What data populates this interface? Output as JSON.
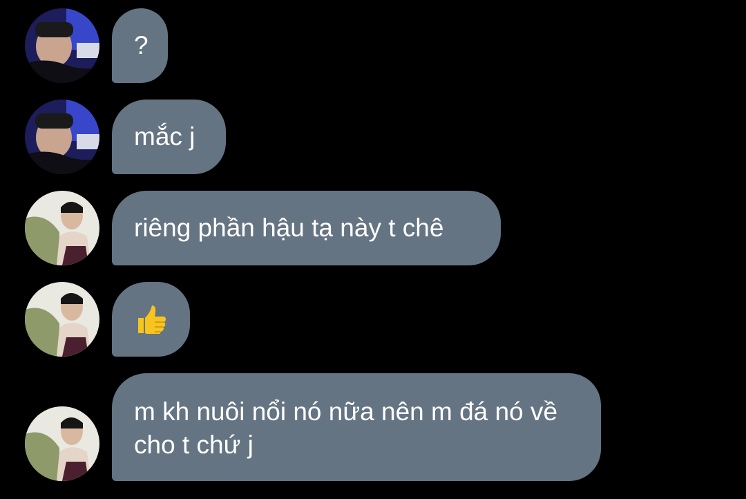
{
  "messages": [
    {
      "sender": "user-a",
      "text": "?"
    },
    {
      "sender": "user-a",
      "text": "mắc j"
    },
    {
      "sender": "user-b",
      "text": "riêng phần hậu tạ này t chê"
    },
    {
      "sender": "user-b",
      "text": "",
      "emoji": "thumbs-up-icon"
    },
    {
      "sender": "user-b",
      "text": "m kh nuôi nổi nó nữa nên m đá nó về cho t chứ j"
    }
  ],
  "colors": {
    "background": "#000000",
    "bubble": "#657482",
    "text": "#ffffff",
    "thumb": "#F7C51E"
  }
}
